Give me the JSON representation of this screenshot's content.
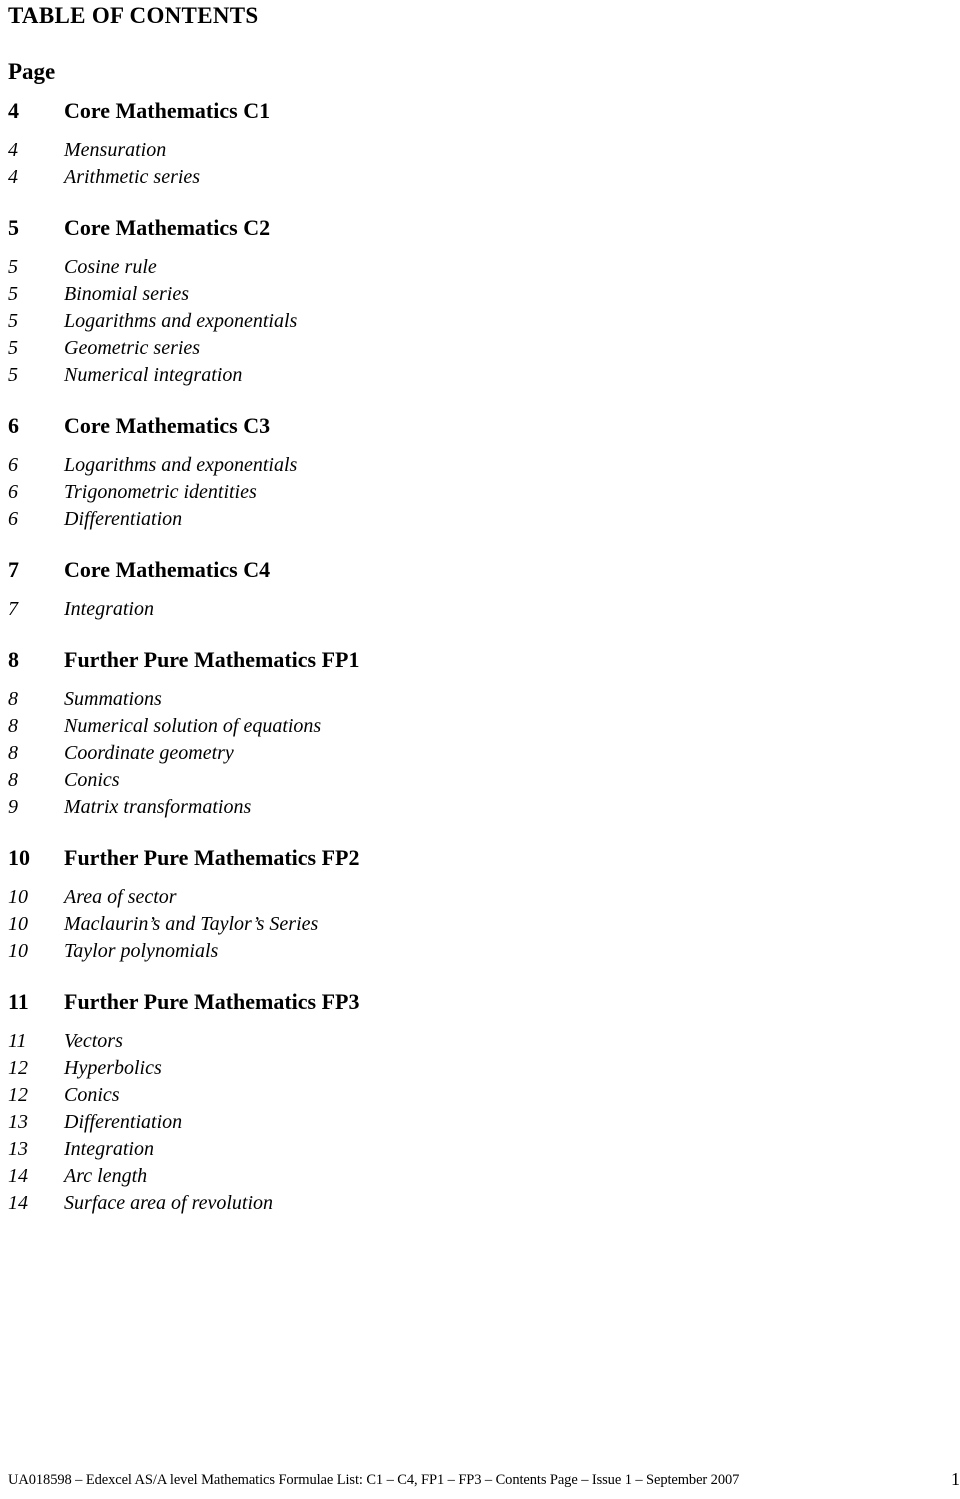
{
  "document": {
    "title": "TABLE OF CONTENTS",
    "page_column_label": "Page"
  },
  "sections": [
    {
      "page": "4",
      "title": "Core Mathematics C1",
      "entries": [
        {
          "page": "4",
          "label": "Mensuration"
        },
        {
          "page": "4",
          "label": "Arithmetic series"
        }
      ]
    },
    {
      "page": "5",
      "title": "Core Mathematics C2",
      "entries": [
        {
          "page": "5",
          "label": "Cosine rule"
        },
        {
          "page": "5",
          "label": "Binomial series"
        },
        {
          "page": "5",
          "label": "Logarithms and exponentials"
        },
        {
          "page": "5",
          "label": "Geometric series"
        },
        {
          "page": "5",
          "label": "Numerical integration"
        }
      ]
    },
    {
      "page": "6",
      "title": "Core Mathematics C3",
      "entries": [
        {
          "page": "6",
          "label": "Logarithms and exponentials"
        },
        {
          "page": "6",
          "label": "Trigonometric identities"
        },
        {
          "page": "6",
          "label": "Differentiation"
        }
      ]
    },
    {
      "page": "7",
      "title": "Core Mathematics C4",
      "entries": [
        {
          "page": "7",
          "label": "Integration"
        }
      ]
    },
    {
      "page": "8",
      "title": "Further Pure Mathematics FP1",
      "entries": [
        {
          "page": "8",
          "label": "Summations"
        },
        {
          "page": "8",
          "label": "Numerical solution of equations"
        },
        {
          "page": "8",
          "label": "Coordinate geometry"
        },
        {
          "page": "8",
          "label": "Conics"
        },
        {
          "page": "9",
          "label": "Matrix transformations"
        }
      ]
    },
    {
      "page": "10",
      "title": "Further Pure Mathematics FP2",
      "entries": [
        {
          "page": "10",
          "label": "Area of sector"
        },
        {
          "page": "10",
          "label": "Maclaurin’s and Taylor’s Series"
        },
        {
          "page": "10",
          "label": "Taylor polynomials"
        }
      ]
    },
    {
      "page": "11",
      "title": "Further Pure Mathematics FP3",
      "entries": [
        {
          "page": "11",
          "label": "Vectors"
        },
        {
          "page": "12",
          "label": "Hyperbolics"
        },
        {
          "page": "12",
          "label": "Conics"
        },
        {
          "page": "13",
          "label": "Differentiation"
        },
        {
          "page": "13",
          "label": "Integration"
        },
        {
          "page": "14",
          "label": "Arc length"
        },
        {
          "page": "14",
          "label": "Surface area of revolution"
        }
      ]
    }
  ],
  "footer": {
    "text": "UA018598 – Edexcel AS/A level Mathematics Formulae List: C1 – C4, FP1 – FP3 – Contents Page – Issue 1 – September 2007",
    "page_number": "1"
  }
}
